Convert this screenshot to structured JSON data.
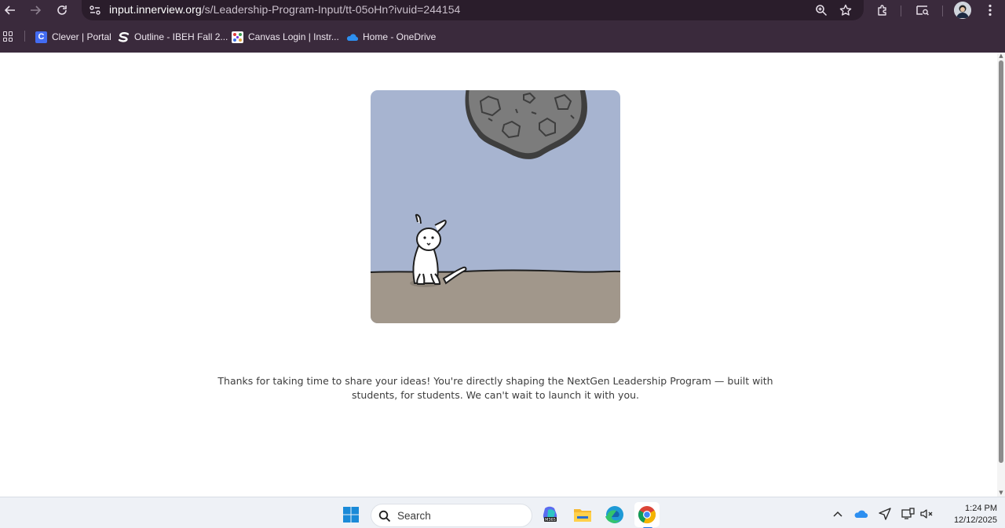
{
  "browser": {
    "url_host": "input.innerview.org",
    "url_path": "/s/Leadership-Program-Input/tt-05oHn?ivuid=244154",
    "bookmarks": [
      {
        "label": "Clever | Portal",
        "icon": "clever-icon"
      },
      {
        "label": "Outline - IBEH Fall 2...",
        "icon": "outline-icon"
      },
      {
        "label": "Canvas Login | Instr...",
        "icon": "canvas-icon"
      },
      {
        "label": "Home - OneDrive",
        "icon": "onedrive-icon"
      }
    ]
  },
  "page": {
    "thanks_line1": "Thanks for taking  time to share your ideas! You're directly shaping the NextGen Leadership Program — built with",
    "thanks_line2": "students, for students. We can't wait to launch it with you.",
    "illustration": "cat-under-falling-rock",
    "colors": {
      "sky": "#a7b4d0",
      "ground": "#a1978b",
      "rock": "#7a7a7a"
    }
  },
  "taskbar": {
    "search_label": "Search",
    "time": "1:24 PM",
    "date": "12/12/2025",
    "apps": [
      "windows-start-icon",
      "m365-copilot-icon",
      "file-explorer-icon",
      "edge-icon",
      "chrome-icon"
    ]
  }
}
